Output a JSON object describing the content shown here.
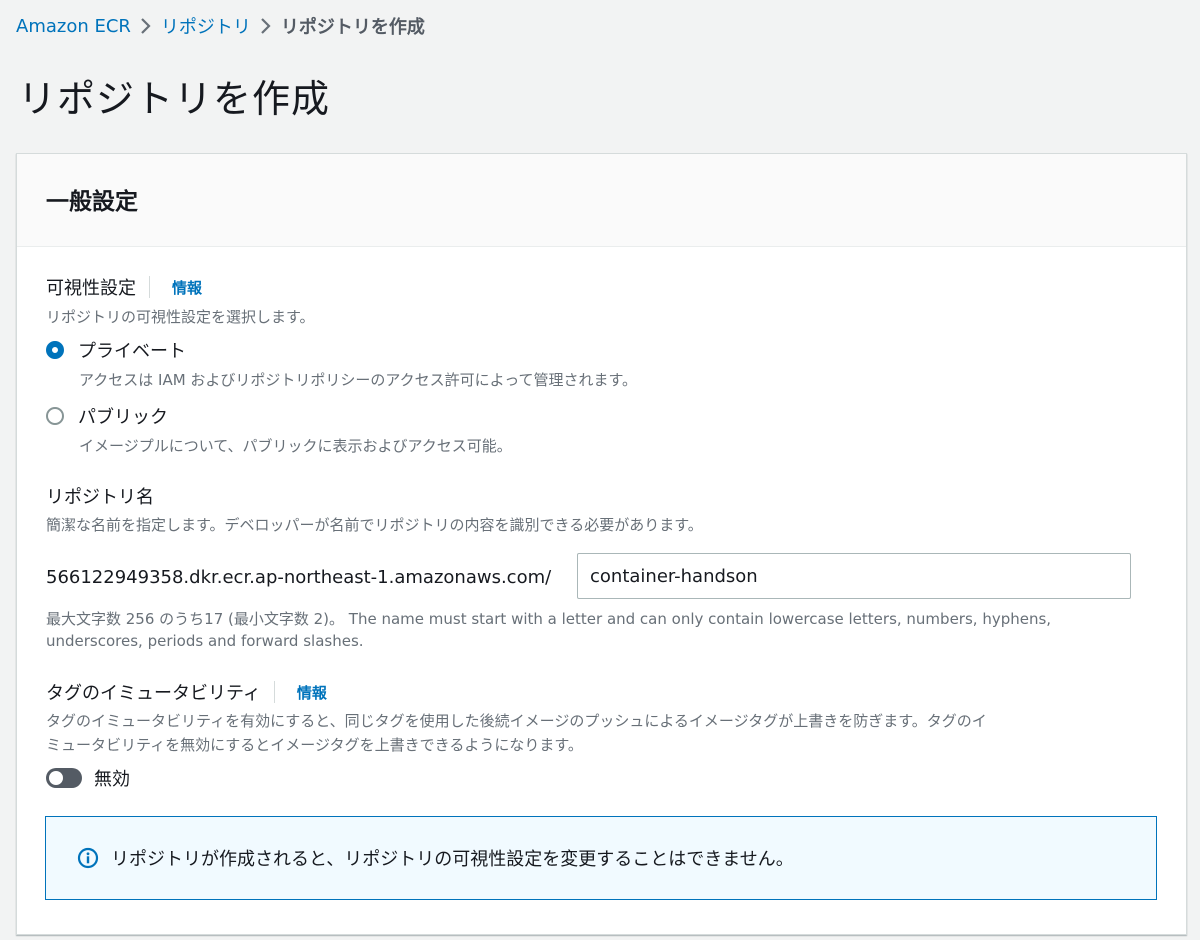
{
  "breadcrumb": {
    "items": [
      "Amazon ECR",
      "リポジトリ"
    ],
    "current": "リポジトリを作成"
  },
  "page": {
    "title": "リポジトリを作成"
  },
  "panel": {
    "title": "一般設定",
    "visibility": {
      "label": "可視性設定",
      "info": "情報",
      "description": "リポジトリの可視性設定を選択します。",
      "selected": "private",
      "options": [
        {
          "label": "プライベート",
          "description": "アクセスは IAM およびリポジトリポリシーのアクセス許可によって管理されます。"
        },
        {
          "label": "パブリック",
          "description": "イメージプルについて、パブリックに表示およびアクセス可能。"
        }
      ]
    },
    "repo_name": {
      "label": "リポジトリ名",
      "description": "簡潔な名前を指定します。デベロッパーが名前でリポジトリの内容を識別できる必要があります。",
      "uri_prefix": "566122949358.dkr.ecr.ap-northeast-1.amazonaws.com/",
      "value": "container-handson",
      "hint_line1": "最大文字数 256 のうち17 (最小文字数 2)。 The name must start with a letter and can only contain lowercase letters, numbers, hyphens,",
      "hint_line2": "underscores, periods and forward slashes."
    },
    "tag_immutability": {
      "label": "タグのイミュータビリティ",
      "info": "情報",
      "description_line1": "タグのイミュータビリティを有効にすると、同じタグを使用した後続イメージのプッシュによるイメージタグが上書きを防ぎます。タグのイ",
      "description_line2": "ミュータビリティを無効にするとイメージタグを上書きできるようになります。",
      "toggle_label": "無効",
      "enabled": false
    },
    "alert": {
      "icon": "info-icon",
      "text": "リポジトリが作成されると、リポジトリの可視性設定を変更することはできません。"
    }
  },
  "colors": {
    "link": "#0073bb",
    "background": "#f2f3f3",
    "alert_bg": "#f1faff"
  }
}
